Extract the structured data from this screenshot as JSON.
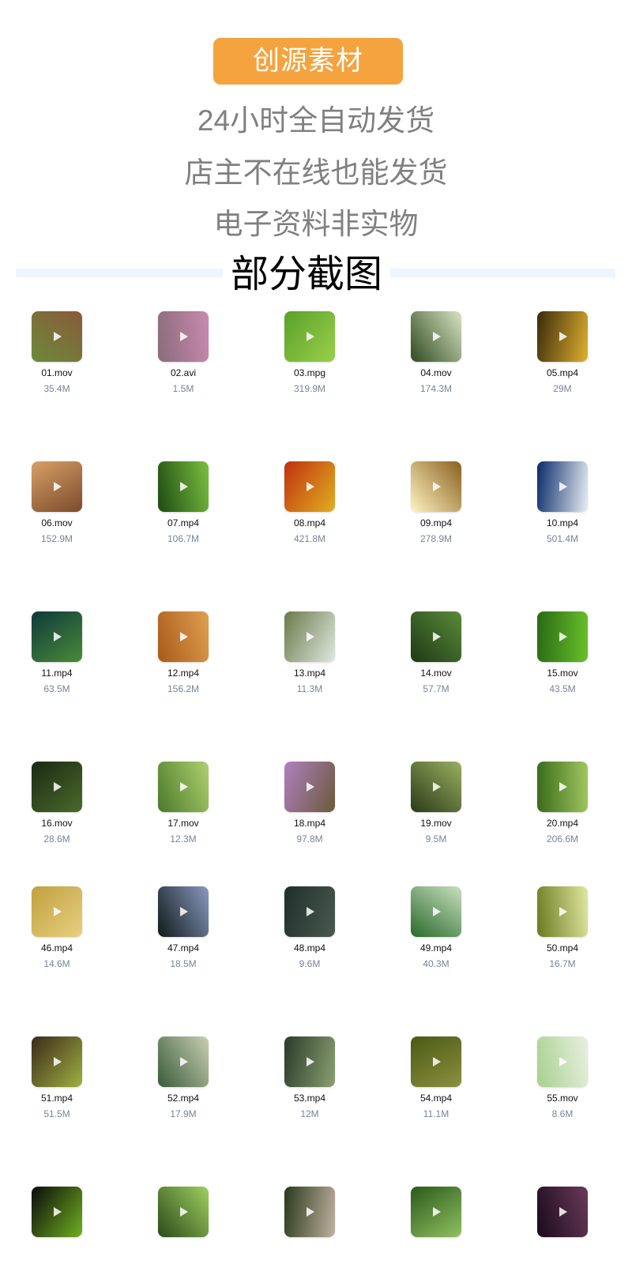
{
  "header": {
    "brand": "创源素材",
    "taglines": [
      "24小时全自动发货",
      "店主不在线也能发货",
      "电子资料非实物"
    ],
    "section_title": "部分截图"
  },
  "colors": {
    "brand_badge": "#f5a33e",
    "tagline_text": "#808080",
    "divider": "#eef5fc",
    "file_size_text": "#77849a"
  },
  "icons": {
    "thumbnail_overlay": "play-icon"
  },
  "files": [
    {
      "name": "01.mov",
      "size": "35.4M",
      "colors": [
        "#6b8a3a",
        "#8a5a3a"
      ]
    },
    {
      "name": "02.avi",
      "size": "1.5M",
      "colors": [
        "#8a6b7a",
        "#c98ab0"
      ]
    },
    {
      "name": "03.mpg",
      "size": "319.9M",
      "colors": [
        "#5aa02a",
        "#9ad04a"
      ]
    },
    {
      "name": "04.mov",
      "size": "174.3M",
      "colors": [
        "#2e4a1e",
        "#d8e4c4"
      ]
    },
    {
      "name": "05.mp4",
      "size": "29M",
      "colors": [
        "#3a2a0a",
        "#e0b030"
      ]
    },
    {
      "name": "06.mov",
      "size": "152.9M",
      "colors": [
        "#d8a068",
        "#7a4a2a"
      ]
    },
    {
      "name": "07.mp4",
      "size": "106.7M",
      "colors": [
        "#1e4a12",
        "#7ac040"
      ]
    },
    {
      "name": "08.mp4",
      "size": "421.8M",
      "colors": [
        "#c03010",
        "#e0b020"
      ]
    },
    {
      "name": "09.mp4",
      "size": "278.9M",
      "colors": [
        "#fff4c0",
        "#8a6020"
      ]
    },
    {
      "name": "10.mp4",
      "size": "501.4M",
      "colors": [
        "#0a2a6a",
        "#e8eef4"
      ]
    },
    {
      "name": "11.mp4",
      "size": "63.5M",
      "colors": [
        "#0e3a3a",
        "#4a8a3a"
      ]
    },
    {
      "name": "12.mp4",
      "size": "156.2M",
      "colors": [
        "#a85a1a",
        "#e0a050"
      ]
    },
    {
      "name": "13.mp4",
      "size": "11.3M",
      "colors": [
        "#6a7a4a",
        "#e0e8e0"
      ]
    },
    {
      "name": "14.mov",
      "size": "57.7M",
      "colors": [
        "#1e3a14",
        "#5a8a3a"
      ]
    },
    {
      "name": "15.mov",
      "size": "43.5M",
      "colors": [
        "#2a6a14",
        "#6ac02a"
      ]
    },
    {
      "name": "16.mov",
      "size": "28.6M",
      "colors": [
        "#1a2a14",
        "#4a6a2a"
      ]
    },
    {
      "name": "17.mov",
      "size": "12.3M",
      "colors": [
        "#4a7a2a",
        "#b0d070"
      ]
    },
    {
      "name": "18.mp4",
      "size": "97.8M",
      "colors": [
        "#b080c0",
        "#6a5a3a"
      ]
    },
    {
      "name": "19.mov",
      "size": "9.5M",
      "colors": [
        "#2a3a1a",
        "#9ab060"
      ]
    },
    {
      "name": "20.mp4",
      "size": "206.6M",
      "colors": [
        "#3a6a1a",
        "#a0c860"
      ]
    },
    {
      "name": "46.mp4",
      "size": "14.6M",
      "colors": [
        "#c0a040",
        "#e8d080"
      ]
    },
    {
      "name": "47.mp4",
      "size": "18.5M",
      "colors": [
        "#0e1a1a",
        "#8a9ac0"
      ]
    },
    {
      "name": "48.mp4",
      "size": "9.6M",
      "colors": [
        "#1e2e2a",
        "#4a5a50"
      ]
    },
    {
      "name": "49.mp4",
      "size": "40.3M",
      "colors": [
        "#2a6a2a",
        "#c8e0c0"
      ]
    },
    {
      "name": "50.mp4",
      "size": "16.7M",
      "colors": [
        "#6a7a20",
        "#e0e8a0"
      ]
    },
    {
      "name": "51.mp4",
      "size": "51.5M",
      "colors": [
        "#3a2a1a",
        "#a0b040"
      ]
    },
    {
      "name": "52.mp4",
      "size": "17.9M",
      "colors": [
        "#3a5a3a",
        "#c8d0b0"
      ]
    },
    {
      "name": "53.mp4",
      "size": "12M",
      "colors": [
        "#2a3a2a",
        "#8aa070"
      ]
    },
    {
      "name": "54.mp4",
      "size": "11.1M",
      "colors": [
        "#4a5a14",
        "#8a9040"
      ]
    },
    {
      "name": "55.mov",
      "size": "8.6M",
      "colors": [
        "#a8d090",
        "#e8f0e0"
      ]
    },
    {
      "name": "",
      "size": "",
      "colors": [
        "#0a0a0a",
        "#70b020"
      ]
    },
    {
      "name": "",
      "size": "",
      "colors": [
        "#2a4a1a",
        "#a0d060"
      ]
    },
    {
      "name": "",
      "size": "",
      "colors": [
        "#2a3a1a",
        "#c0b0a0"
      ]
    },
    {
      "name": "",
      "size": "",
      "colors": [
        "#2a5a1a",
        "#90c060"
      ]
    },
    {
      "name": "",
      "size": "",
      "colors": [
        "#1a0a1a",
        "#6a3a5a"
      ]
    }
  ]
}
